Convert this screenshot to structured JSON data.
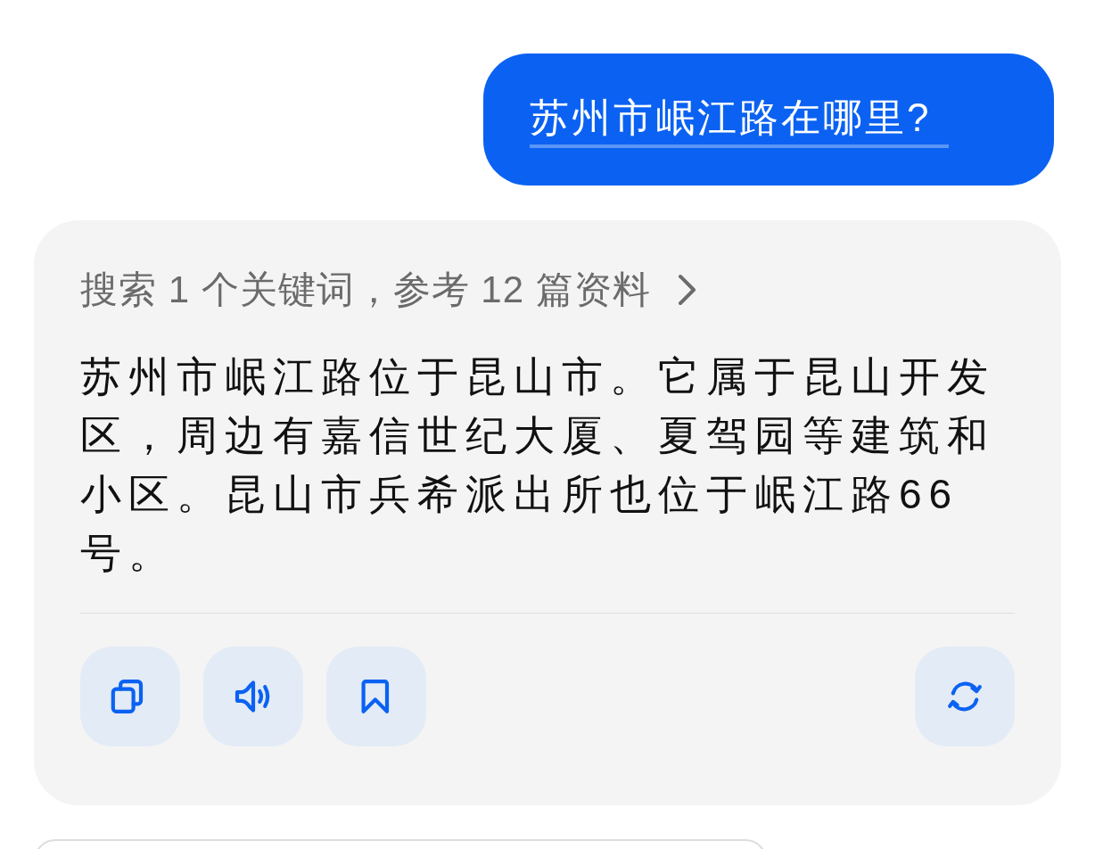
{
  "user_message": {
    "text": "苏州市岷江路在哪里?"
  },
  "reply": {
    "sources_link": "搜索 1 个关键词，参考 12 篇资料",
    "answer": "苏州市岷江路位于昆山市。它属于昆山开发区，周边有嘉信世纪大厦、夏驾园等建筑和小区。昆山市兵希派出所也位于岷江路66号。",
    "actions": [
      {
        "kind": "copy"
      },
      {
        "kind": "speak"
      },
      {
        "kind": "bookmark"
      },
      {
        "kind": "regenerate"
      }
    ]
  }
}
